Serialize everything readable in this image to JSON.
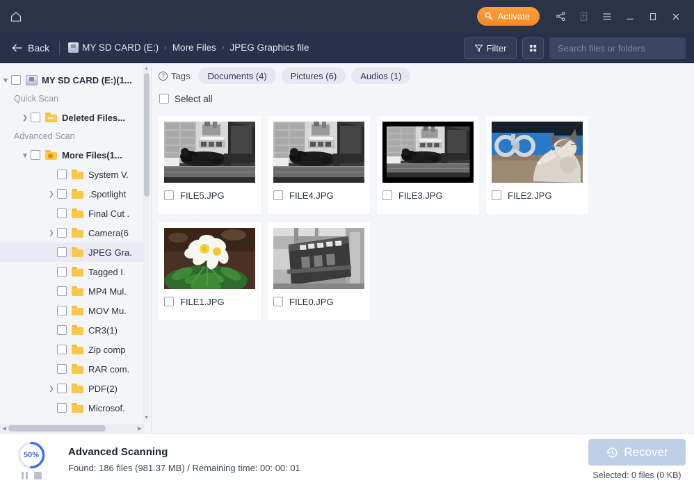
{
  "titlebar": {
    "home_icon": "home-icon",
    "activate_label": "Activate",
    "activate_icon": "key-icon",
    "share_icon": "share-icon",
    "upgrade_icon": "upgrade-icon",
    "menu_icon": "hamburger-menu-icon",
    "minimize_icon": "minimize-icon",
    "maximize_icon": "maximize-icon",
    "close_icon": "close-icon",
    "bg_color": "#2b3348",
    "accent_color": "#f58a28"
  },
  "toolbar": {
    "back_label": "Back",
    "back_icon": "arrow-left-icon",
    "breadcrumb": [
      {
        "label": "MY SD CARD (E:)",
        "icon": "disk-icon"
      },
      {
        "label": "More Files",
        "icon": ""
      },
      {
        "label": "JPEG Graphics file",
        "icon": ""
      }
    ],
    "breadcrumb_separator": "›",
    "filter_label": "Filter",
    "filter_icon": "funnel-icon",
    "view_icon": "grid-view-icon",
    "search_placeholder": "Search files or folders",
    "search_value": "",
    "search_icon": "search-icon"
  },
  "sidebar": {
    "items": [
      {
        "label": "MY SD CARD (E:)(1...",
        "type": "disk",
        "chevron": "open",
        "indent": 6,
        "bold": true,
        "checkbox": true,
        "selected": false
      },
      {
        "label": "Quick Scan",
        "type": "section",
        "indent": 20
      },
      {
        "label": "Deleted Files...",
        "type": "folder-minus",
        "chevron": "closed",
        "indent": 44,
        "bold": true,
        "checkbox": true,
        "selected": false
      },
      {
        "label": "Advanced Scan",
        "type": "section",
        "indent": 20
      },
      {
        "label": "More Files(1...",
        "type": "folder-badge",
        "chevron": "open",
        "indent": 44,
        "bold": true,
        "checkbox": true,
        "selected": false
      },
      {
        "label": "System V.",
        "type": "folder",
        "chevron": "none",
        "indent": 82,
        "bold": false,
        "checkbox": true,
        "selected": false
      },
      {
        "label": ".Spotlight",
        "type": "folder",
        "chevron": "closed",
        "indent": 82,
        "bold": false,
        "checkbox": true,
        "selected": false
      },
      {
        "label": "Final Cut .",
        "type": "folder",
        "chevron": "none",
        "indent": 82,
        "bold": false,
        "checkbox": true,
        "selected": false
      },
      {
        "label": "Camera(6",
        "type": "folder",
        "chevron": "closed",
        "indent": 82,
        "bold": false,
        "checkbox": true,
        "selected": false
      },
      {
        "label": "JPEG Gra.",
        "type": "folder",
        "chevron": "none",
        "indent": 82,
        "bold": false,
        "checkbox": true,
        "selected": true
      },
      {
        "label": "Tagged I.",
        "type": "folder",
        "chevron": "none",
        "indent": 82,
        "bold": false,
        "checkbox": true,
        "selected": false
      },
      {
        "label": "MP4 Mul.",
        "type": "folder",
        "chevron": "none",
        "indent": 82,
        "bold": false,
        "checkbox": true,
        "selected": false
      },
      {
        "label": "MOV Mu.",
        "type": "folder",
        "chevron": "none",
        "indent": 82,
        "bold": false,
        "checkbox": true,
        "selected": false
      },
      {
        "label": "CR3(1)",
        "type": "folder",
        "chevron": "none",
        "indent": 82,
        "bold": false,
        "checkbox": true,
        "selected": false
      },
      {
        "label": "Zip comp",
        "type": "folder",
        "chevron": "none",
        "indent": 82,
        "bold": false,
        "checkbox": true,
        "selected": false
      },
      {
        "label": "RAR com.",
        "type": "folder",
        "chevron": "none",
        "indent": 82,
        "bold": false,
        "checkbox": true,
        "selected": false
      },
      {
        "label": "PDF(2)",
        "type": "folder",
        "chevron": "closed",
        "indent": 82,
        "bold": false,
        "checkbox": true,
        "selected": false
      },
      {
        "label": "Microsof.",
        "type": "folder",
        "chevron": "none",
        "indent": 82,
        "bold": false,
        "checkbox": true,
        "selected": false
      }
    ]
  },
  "content": {
    "tags_label": "Tags",
    "tags_help_icon": "question-mark-icon",
    "chips": [
      {
        "label": "Documents (4)"
      },
      {
        "label": "Pictures (6)"
      },
      {
        "label": "Audios (1)"
      }
    ],
    "select_all_label": "Select all",
    "select_all_checked": false,
    "files": [
      {
        "name": "FILE5.JPG",
        "thumb": "street-bw",
        "checked": false
      },
      {
        "name": "FILE4.JPG",
        "thumb": "street-bw",
        "checked": false
      },
      {
        "name": "FILE3.JPG",
        "thumb": "street-bw-dark",
        "checked": false
      },
      {
        "name": "FILE2.JPG",
        "thumb": "cat-blue",
        "checked": false
      },
      {
        "name": "FILE1.JPG",
        "thumb": "white-flower",
        "checked": false
      },
      {
        "name": "FILE0.JPG",
        "thumb": "machine-bw",
        "checked": false
      }
    ]
  },
  "footer": {
    "progress_percent": "50%",
    "progress_value": 50,
    "pause_icon": "pause-icon",
    "stop_icon": "stop-icon",
    "scan_title": "Advanced Scanning",
    "scan_status": "Found: 186 files (981.37 MB) / Remaining time: 00: 00: 01",
    "recover_label": "Recover",
    "recover_icon": "restore-clock-icon",
    "selected_text": "Selected: 0 files (0 KB)"
  }
}
